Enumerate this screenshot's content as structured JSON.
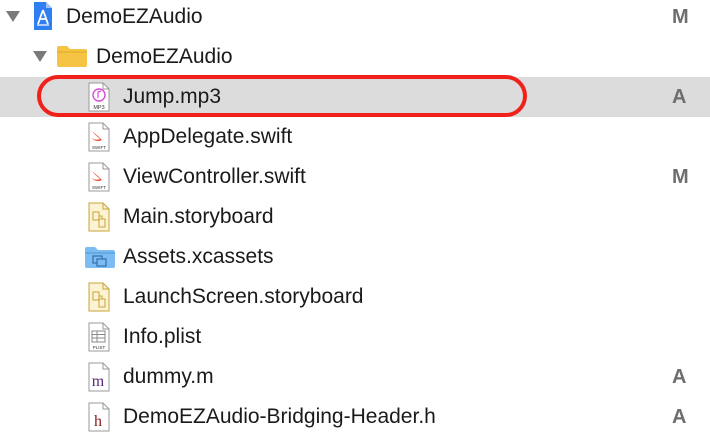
{
  "project": {
    "name": "DemoEZAudio",
    "status": "M"
  },
  "group": {
    "name": "DemoEZAudio"
  },
  "files": [
    {
      "name": "Jump.mp3",
      "status": "A",
      "icon": "mp3-file-icon",
      "icon_text": "MP3"
    },
    {
      "name": "AppDelegate.swift",
      "status": "",
      "icon": "swift-file-icon",
      "icon_text": "SWIFT"
    },
    {
      "name": "ViewController.swift",
      "status": "M",
      "icon": "swift-file-icon",
      "icon_text": "SWIFT"
    },
    {
      "name": "Main.storyboard",
      "status": "",
      "icon": "storyboard-file-icon",
      "icon_text": ""
    },
    {
      "name": "Assets.xcassets",
      "status": "",
      "icon": "asset-catalog-folder-icon",
      "icon_text": ""
    },
    {
      "name": "LaunchScreen.storyboard",
      "status": "",
      "icon": "storyboard-file-icon",
      "icon_text": ""
    },
    {
      "name": "Info.plist",
      "status": "",
      "icon": "plist-file-icon",
      "icon_text": "PLIST"
    },
    {
      "name": "dummy.m",
      "status": "A",
      "icon": "objc-implementation-file-icon",
      "icon_text": "m"
    },
    {
      "name": "DemoEZAudio-Bridging-Header.h",
      "status": "A",
      "icon": "header-file-icon",
      "icon_text": "h"
    }
  ],
  "colors": {
    "selection": "#dcdcdc",
    "highlight": "#f0211b",
    "folder": "#f5c443",
    "project": "#2f7ff0"
  }
}
